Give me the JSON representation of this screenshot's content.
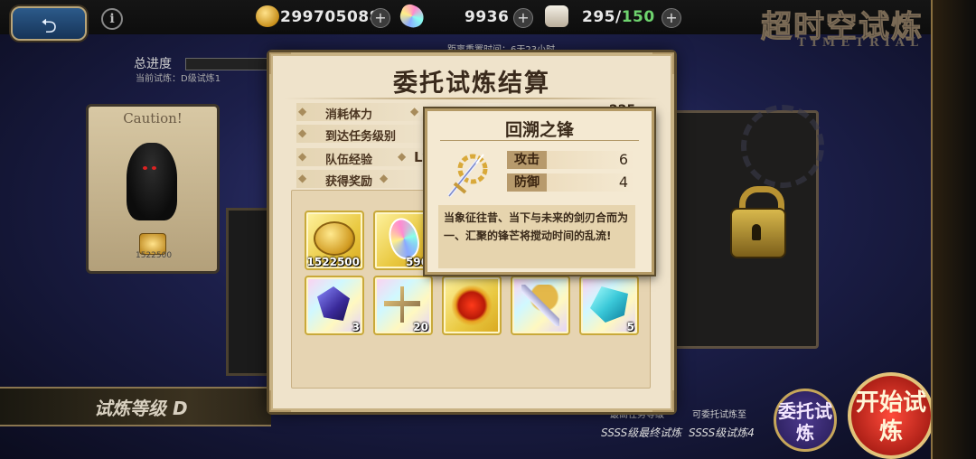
{
  "header": {
    "back_glyph": "⮌",
    "info_glyph": "i",
    "gold": "299705088",
    "crystal": "9936",
    "stamina_current": "295",
    "stamina_separator": "/",
    "stamina_max": "150",
    "plus_glyph": "+",
    "logo_cn": "超时空试炼",
    "logo_en": "TIMETRIAL"
  },
  "background": {
    "progress_label": "总进度",
    "progress_sub": "当前试炼：D级试炼1",
    "reset_info": "距离重置时间：6天23小时",
    "caution": "Caution!",
    "left_card_count": "1522500",
    "level_label": "试炼等级 D",
    "highest_label": "最高任务等级",
    "entrustable_label": "可委托试炼至",
    "highest_value": "SSSS级最终试炼",
    "entrustable_value": "SSSS级试炼4",
    "entrust_button": "委托试炼",
    "start_button": "开始试炼"
  },
  "modal": {
    "title": "委托试炼结算",
    "rows": [
      {
        "label": "消耗体力",
        "value": "225"
      },
      {
        "label": "到达任务级别",
        "value": ""
      },
      {
        "label": "队伍经验",
        "value": "Lv"
      },
      {
        "label": "获得奖励",
        "value": ""
      }
    ],
    "rewards": [
      {
        "icon": "gold-coin-icon",
        "count": "1522500"
      },
      {
        "icon": "rainbow-crystal-icon",
        "count": "596"
      },
      {
        "icon": "dark-shard-icon",
        "count": "3"
      },
      {
        "icon": "silver-cross-icon",
        "count": "20"
      },
      {
        "icon": "fire-sun-icon",
        "count": ""
      },
      {
        "icon": "chrono-sword-icon",
        "count": ""
      },
      {
        "icon": "ice-crystal-icon",
        "count": "5"
      }
    ]
  },
  "tooltip": {
    "title": "回溯之锋",
    "icon": "chrono-sword-icon",
    "stats": [
      {
        "label": "攻击",
        "value": "6"
      },
      {
        "label": "防御",
        "value": "4"
      }
    ],
    "description": "当象征往昔、当下与未来的剑刃合而为一、汇聚的锋芒将搅动时间的乱流!"
  }
}
